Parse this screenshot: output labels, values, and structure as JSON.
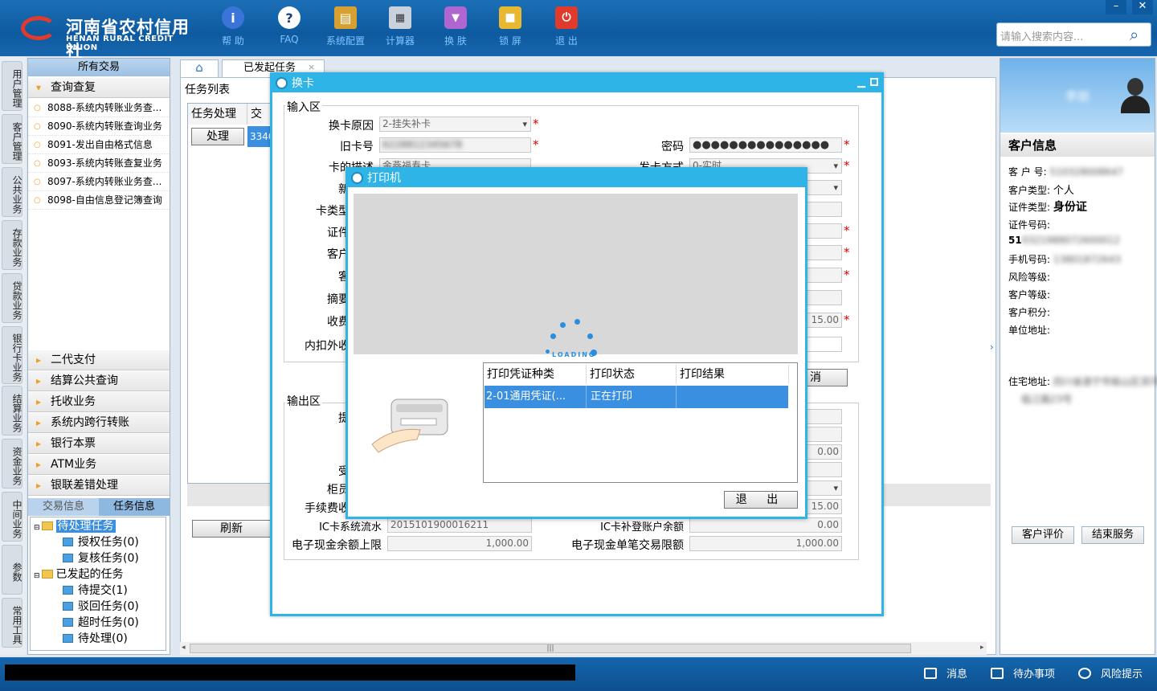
{
  "header": {
    "logo_cn": "河南省农村信用社",
    "logo_en": "HENAN RURAL CREDIT UNION",
    "toolbar": [
      {
        "label": "帮 助",
        "icon": "info-icon"
      },
      {
        "label": "FAQ",
        "icon": "question-icon"
      },
      {
        "label": "系统配置",
        "icon": "toolbox-icon"
      },
      {
        "label": "计算器",
        "icon": "calculator-icon"
      },
      {
        "label": "换 肤",
        "icon": "shirt-icon"
      },
      {
        "label": "锁 屏",
        "icon": "lock-icon"
      },
      {
        "label": "退 出",
        "icon": "power-icon"
      }
    ],
    "search_placeholder": "请输入搜索内容...",
    "win_min": "–",
    "win_close": "✕"
  },
  "vtabs": [
    "用户管理",
    "客户管理",
    "公共业务",
    "存款业务",
    "贷款业务",
    "银行卡业务",
    "结算业务",
    "资金业务",
    "中间业务",
    "参数",
    "常用工具"
  ],
  "menu": {
    "title": "所有交易",
    "open_group": "查询查复",
    "items": [
      "8088-系统内转账业务查...",
      "8090-系统内转账查询业务",
      "8091-发出自由格式信息",
      "8093-系统内转账查复业务",
      "8097-系统内转账业务查...",
      "8098-自由信息登记簿查询"
    ],
    "groups": [
      "二代支付",
      "结算公共查询",
      "托收业务",
      "系统内跨行转账",
      "银行本票",
      "ATM业务",
      "银联差错处理"
    ],
    "tab_trade": "交易信息",
    "tab_task": "任务信息",
    "tree": {
      "pending": "待处理任务",
      "auth": "授权任务(0)",
      "review": "复核任务(0)",
      "launched": "已发起的任务",
      "to_submit": "待提交(1)",
      "rejected": "驳回任务(0)",
      "timeout": "超时任务(0)",
      "to_process": "待处理(0)"
    }
  },
  "main": {
    "tab_task": "已发起任务",
    "tab_close": "×",
    "task_list": "任务列表",
    "col_process": "任务处理",
    "col_trade": "交易",
    "process_btn": "处理",
    "row_code": "3340",
    "refresh_btn": "刷新",
    "scroll_grip": "|||"
  },
  "card_dialog": {
    "title": "换卡",
    "input_area": "输入区",
    "output_area": "输出区",
    "labels": {
      "reason": "换卡原因",
      "old_card": "旧卡号",
      "card_desc": "卡的描述",
      "new": "新",
      "card_type": "卡类型",
      "cert": "证件",
      "cust": "客户",
      "cust2": "客",
      "summary": "摘要",
      "fee": "收费",
      "fee_inout": "内扣外收",
      "password": "密码",
      "issue_mode": "发卡方式",
      "out_t": "提",
      "out_s": "受",
      "teller": "柜员",
      "fee_charge": "手续费收",
      "ic_serial": "IC卡系统流水",
      "ic_balance": "IC卡补登账户余额",
      "ecash_limit": "电子现金余额上限",
      "ecash_single": "电子现金单笔交易限额"
    },
    "values": {
      "reason": "2-挂失补卡",
      "old_card": "6228812345678",
      "card_desc": "金燕福寿卡",
      "password": "●●●●●●●●●●●●●●●",
      "issue_mode": "0-实时",
      "fee": "15.00",
      "out_amount": "0.00",
      "fee_charge": "15.00",
      "ic_serial": "2015101900016211",
      "ic_balance": "0.00",
      "ecash_limit": "1,000.00",
      "ecash_single": "1,000.00"
    },
    "cancel": "消",
    "required_mark": "*"
  },
  "print_dialog": {
    "title": "打印机",
    "loading": "LOADING",
    "headers": [
      "打印凭证种类",
      "打印状态",
      "打印结果"
    ],
    "row": {
      "type": "2-01通用凭证(...",
      "status": "正在打印",
      "result": ""
    },
    "exit": "退 出"
  },
  "customer": {
    "name": "李丽",
    "title": "客户信息",
    "fields": {
      "no_label": "客 户 号:",
      "no_value": "510328008647",
      "type_label": "客户类型:",
      "type_value": "个人",
      "cert_type_label": "证件类型:",
      "cert_type_value": "身份证",
      "cert_no_label": "证件号码:",
      "cert_no_prefix": "51",
      "cert_no_rest": "0321988072600012",
      "phone_label": "手机号码:",
      "phone_value": "13801872643",
      "risk_label": "风险等级:",
      "level_label": "客户等级:",
      "points_label": "客户积分:",
      "unit_label": "单位地址:",
      "home_label": "住宅地址:",
      "home_value": "四川省遂宁市船山区滨河街",
      "home_value2": "临江路23号"
    },
    "eval_btn": "客户评价",
    "end_btn": "结束服务"
  },
  "status": {
    "msg": "消息",
    "todo": "待办事项",
    "risk": "风险提示"
  }
}
